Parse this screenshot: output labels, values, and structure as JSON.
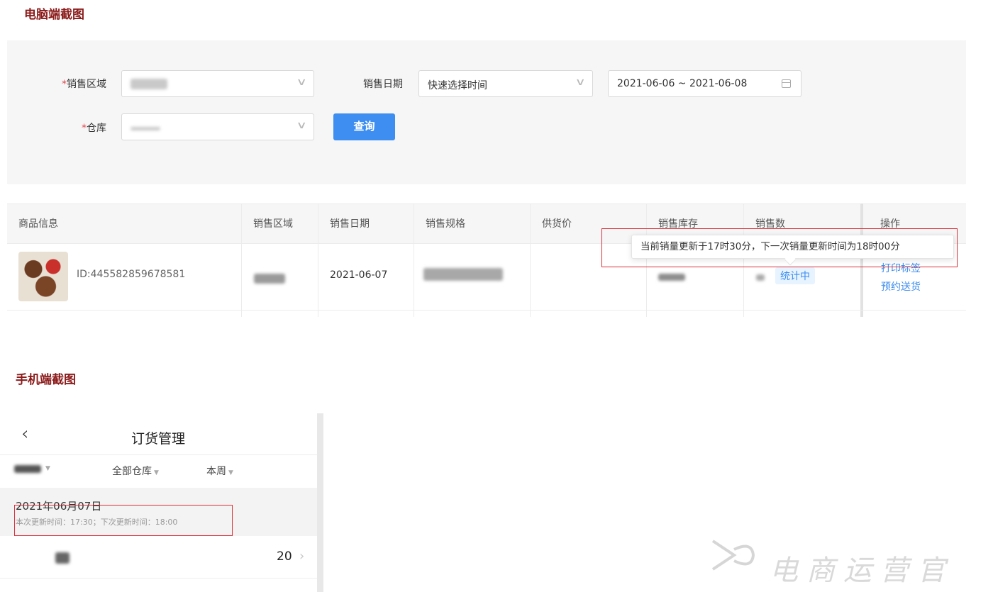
{
  "sections": {
    "pc_title": "电脑端截图",
    "mobile_title": "手机端截图"
  },
  "filters": {
    "region_label": "销售区域",
    "required_mark": "*",
    "region_value": "",
    "warehouse_label": "仓库",
    "warehouse_value": "",
    "date_label": "销售日期",
    "quick_date_value": "快速选择时间",
    "date_range": "2021-06-06 ~ 2021-06-08",
    "query_button": "查询"
  },
  "table": {
    "headers": [
      "商品信息",
      "销售区域",
      "销售日期",
      "销售规格",
      "供货价",
      "销售库存",
      "销售数",
      "操作"
    ],
    "row": {
      "product_id": "ID:445582859678581",
      "sale_date": "2021-06-07",
      "sales_status": "统计中",
      "actions": [
        "打印标签",
        "预约送货"
      ]
    }
  },
  "tooltip": {
    "text": "当前销量更新于17时30分，下一次销量更新时间为18时00分"
  },
  "mobile": {
    "back_icon": "chevron-left-icon",
    "title": "订货管理",
    "filter_all_warehouse": "全部仓库",
    "filter_week": "本周",
    "date_header": "2021年06月07日",
    "update_info": "本次更新时间：17:30；下次更新时间：18:00",
    "row_value": "20"
  },
  "watermark": {
    "text": "电商运营官"
  },
  "colors": {
    "section_title": "#8b1a1a",
    "primary": "#3d8ef0",
    "highlight_box": "#d9303a",
    "required": "#e5484d"
  }
}
